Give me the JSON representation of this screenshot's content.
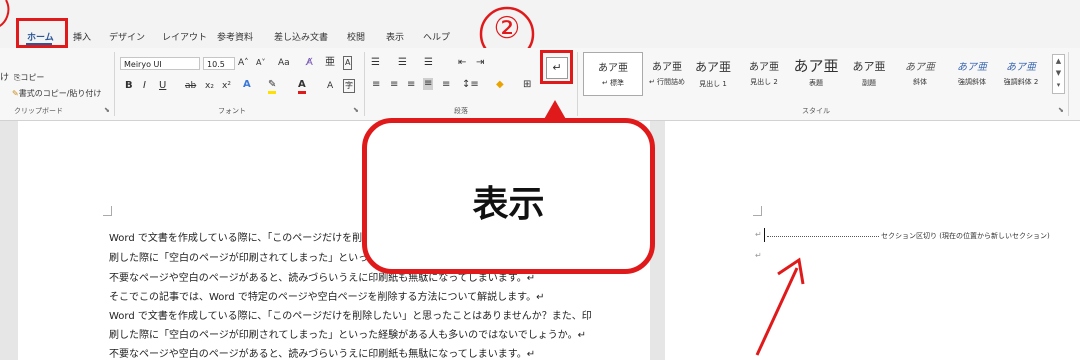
{
  "tabs": [
    "ホーム",
    "挿入",
    "デザイン",
    "レイアウト",
    "参考資料",
    "差し込み文書",
    "校閲",
    "表示",
    "ヘルプ"
  ],
  "clipboard": {
    "paste_partial": "け",
    "copy_label": "コピー",
    "format_painter_label": "書式のコピー/貼り付け",
    "group_label": "クリップボード"
  },
  "font": {
    "name": "Meiryo UI",
    "size": "10.5",
    "group_label": "フォント"
  },
  "paragraph": {
    "group_label": "段落"
  },
  "styles": {
    "group_label": "スタイル",
    "items": [
      {
        "preview": "あア亜",
        "name": "↵ 標準"
      },
      {
        "preview": "あア亜",
        "name": "↵ 行間詰め"
      },
      {
        "preview": "あア亜",
        "name": "見出し 1"
      },
      {
        "preview": "あア亜",
        "name": "見出し 2"
      },
      {
        "preview": "あア亜",
        "name": "表題"
      },
      {
        "preview": "あア亜",
        "name": "副題"
      },
      {
        "preview": "あア亜",
        "name": "斜体"
      },
      {
        "preview": "あア亜",
        "name": "強調斜体"
      },
      {
        "preview": "あア亜",
        "name": "強調斜体 2"
      }
    ]
  },
  "annotation": {
    "step_number": "②",
    "callout_text": "表示",
    "accent_color": "#e01a1a"
  },
  "document": {
    "lines": [
      "Word で文書を作成している際に、「このページだけを削除",
      "刷した際に「空白のページが印刷されてしまった」といった経験",
      "不要なページや空白のページがあると、読みづらいうえに印刷紙も無駄になってしまいます。↵",
      "そこでこの記事では、Word で特定のページや空白ページを削除する方法について解説します。↵",
      "Word で文書を作成している際に、「このページだけを削除したい」と思ったことはありませんか？また、印",
      "刷した際に「空白のページが印刷されてしまった」といった経験がある人も多いのではないでしょうか。↵",
      "不要なページや空白のページがあると、読みづらいうえに印刷紙も無駄になってしまいます。↵"
    ],
    "section_break": "セクション区切り (現在の位置から新しいセクション)",
    "pilcrow": "↵"
  }
}
